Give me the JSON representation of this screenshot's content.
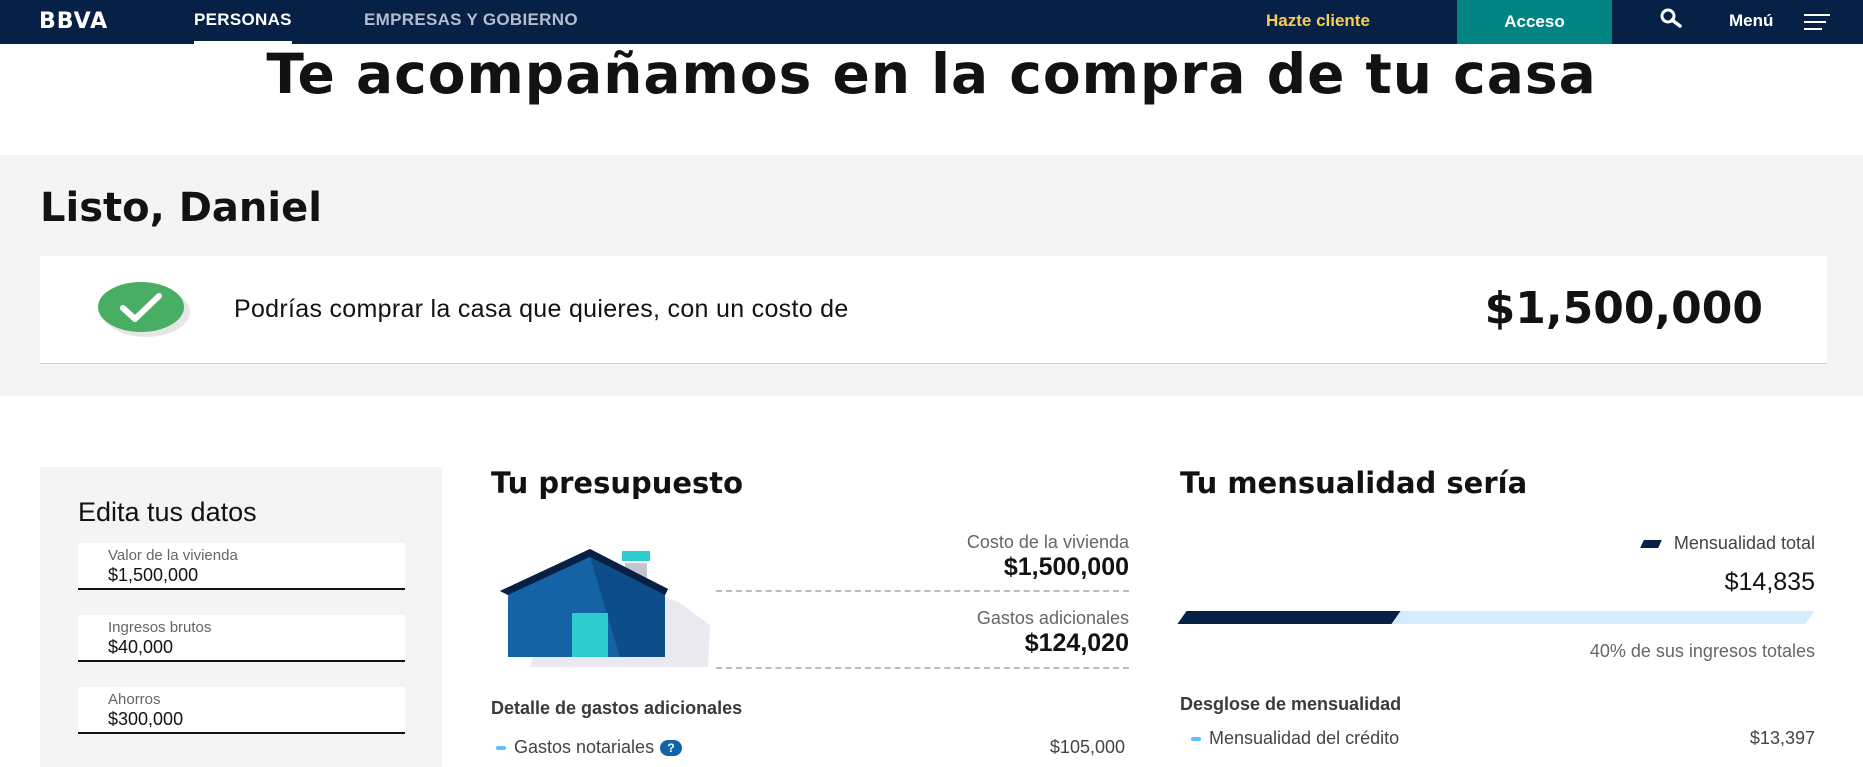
{
  "nav": {
    "logo": "BBVA",
    "tab_personas": "PERSONAS",
    "tab_empresas": "EMPRESAS Y GOBIERNO",
    "hazte_cliente": "Hazte cliente",
    "acceso": "Acceso",
    "menu": "Menú"
  },
  "hero": {
    "title": "Te acompañamos en la compra de tu casa"
  },
  "result": {
    "greeting": "Listo, Daniel",
    "message": "Podrías comprar la casa que quieres, con un costo de",
    "amount": "$1,500,000"
  },
  "edit": {
    "title": "Edita tus datos",
    "fields": [
      {
        "label": "Valor de la vivienda",
        "value": "$1,500,000"
      },
      {
        "label": "Ingresos brutos",
        "value": "$40,000"
      },
      {
        "label": "Ahorros",
        "value": "$300,000"
      }
    ]
  },
  "budget": {
    "title": "Tu presupuesto",
    "cost_label": "Costo de la vivienda",
    "cost_value": "$1,500,000",
    "extra_label": "Gastos adicionales",
    "extra_value": "$124,020",
    "detail_title": "Detalle de gastos adicionales",
    "detail_rows": [
      {
        "label": "Gastos notariales",
        "amount": "$105,000",
        "help": "?"
      }
    ]
  },
  "monthly": {
    "title": "Tu mensualidad sería",
    "legend": "Mensualidad total",
    "amount": "$14,835",
    "ratio_fraction": 0.34,
    "percent_text": "40% de sus ingresos totales",
    "breakdown_title": "Desglose de mensualidad",
    "breakdown_rows": [
      {
        "label": "Mensualidad del crédito",
        "amount": "$13,397"
      }
    ]
  },
  "colors": {
    "navy": "#072146",
    "teal": "#028484",
    "yellow": "#f8cd51",
    "green": "#48ae64",
    "light_blue": "#d4edfc",
    "mid_blue": "#1464a5"
  },
  "icons": [
    "search-icon",
    "menu-icon",
    "check-icon",
    "house-icon",
    "help-icon"
  ]
}
